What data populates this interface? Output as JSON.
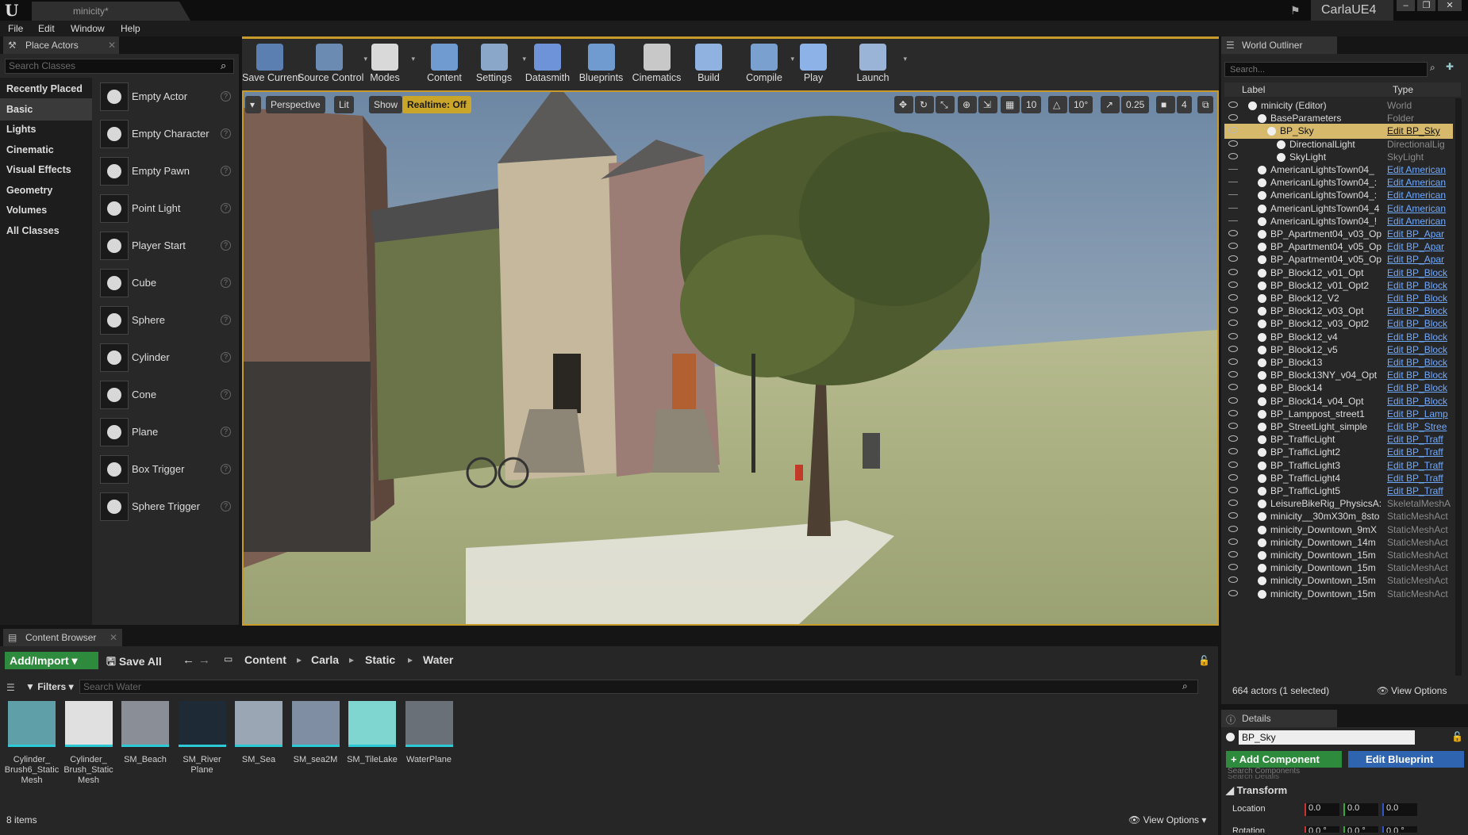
{
  "window": {
    "document_tab": "minicity*",
    "project_name": "CarlaUE4",
    "menus": [
      "File",
      "Edit",
      "Window",
      "Help"
    ]
  },
  "place_actors": {
    "tab_label": "Place Actors",
    "search_placeholder": "Search Classes",
    "categories": [
      "Recently Placed",
      "Basic",
      "Lights",
      "Cinematic",
      "Visual Effects",
      "Geometry",
      "Volumes",
      "All Classes"
    ],
    "selected_category": "Basic",
    "items": [
      "Empty Actor",
      "Empty Character",
      "Empty Pawn",
      "Point Light",
      "Player Start",
      "Cube",
      "Sphere",
      "Cylinder",
      "Cone",
      "Plane",
      "Box Trigger",
      "Sphere Trigger"
    ]
  },
  "toolbar": {
    "tools": [
      {
        "label": "Save Current",
        "icon": "save-icon",
        "color": "#5a7fb0"
      },
      {
        "label": "Source Control",
        "icon": "source-control-icon",
        "color": "#6c8bb2"
      },
      {
        "label": "Modes",
        "icon": "modes-icon",
        "color": "#d9d9d9"
      },
      {
        "label": "Content",
        "icon": "content-icon",
        "color": "#6f9bd1"
      },
      {
        "label": "Settings",
        "icon": "settings-icon",
        "color": "#8aa6c8"
      },
      {
        "label": "Datasmith",
        "icon": "datasmith-icon",
        "color": "#6e93d8"
      },
      {
        "label": "Blueprints",
        "icon": "blueprints-icon",
        "color": "#6f9bd1"
      },
      {
        "label": "Cinematics",
        "icon": "cinematics-icon",
        "color": "#c8c8c8"
      },
      {
        "label": "Build",
        "icon": "build-icon",
        "color": "#8fb2e0"
      },
      {
        "label": "Compile",
        "icon": "compile-icon",
        "color": "#7aa0d0"
      },
      {
        "label": "Play",
        "icon": "play-icon",
        "color": "#8db2e8"
      },
      {
        "label": "Launch",
        "icon": "launch-icon",
        "color": "#9ab4d8"
      }
    ]
  },
  "viewport": {
    "perspective_label": "Perspective",
    "lit_label": "Lit",
    "show_label": "Show",
    "realtime_label": "Realtime: Off",
    "grid_snap": "10",
    "rotation_snap": "10°",
    "scale_snap": "0.25",
    "camera_speed": "4"
  },
  "outliner": {
    "tab_label": "World Outliner",
    "search_placeholder": "Search...",
    "col_label": "Label",
    "col_type": "Type",
    "rows": [
      {
        "name": "minicity (Editor)",
        "type": "World",
        "level": 1,
        "visible": true,
        "type_link": false,
        "selected": false
      },
      {
        "name": "BaseParameters",
        "type": "Folder",
        "level": 2,
        "visible": true,
        "type_link": false,
        "selected": false
      },
      {
        "name": "BP_Sky",
        "type": "Edit BP_Sky",
        "level": 3,
        "visible": true,
        "type_link": true,
        "selected": true
      },
      {
        "name": "DirectionalLight",
        "type": "DirectionalLig",
        "level": 4,
        "visible": true,
        "type_link": false,
        "selected": false
      },
      {
        "name": "SkyLight",
        "type": "SkyLight",
        "level": 4,
        "visible": true,
        "type_link": false,
        "selected": false
      },
      {
        "name": "AmericanLightsTown04_",
        "type": "Edit American",
        "level": 2,
        "visible": false,
        "type_link": true,
        "selected": false
      },
      {
        "name": "AmericanLightsTown04_:",
        "type": "Edit American",
        "level": 2,
        "visible": false,
        "type_link": true,
        "selected": false
      },
      {
        "name": "AmericanLightsTown04_:",
        "type": "Edit American",
        "level": 2,
        "visible": false,
        "type_link": true,
        "selected": false
      },
      {
        "name": "AmericanLightsTown04_4",
        "type": "Edit American",
        "level": 2,
        "visible": false,
        "type_link": true,
        "selected": false
      },
      {
        "name": "AmericanLightsTown04_!",
        "type": "Edit American",
        "level": 2,
        "visible": false,
        "type_link": true,
        "selected": false
      },
      {
        "name": "BP_Apartment04_v03_Op",
        "type": "Edit BP_Apar",
        "level": 2,
        "visible": true,
        "type_link": true,
        "selected": false
      },
      {
        "name": "BP_Apartment04_v05_Op",
        "type": "Edit BP_Apar",
        "level": 2,
        "visible": true,
        "type_link": true,
        "selected": false
      },
      {
        "name": "BP_Apartment04_v05_Op",
        "type": "Edit BP_Apar",
        "level": 2,
        "visible": true,
        "type_link": true,
        "selected": false
      },
      {
        "name": "BP_Block12_v01_Opt",
        "type": "Edit BP_Block",
        "level": 2,
        "visible": true,
        "type_link": true,
        "selected": false
      },
      {
        "name": "BP_Block12_v01_Opt2",
        "type": "Edit BP_Block",
        "level": 2,
        "visible": true,
        "type_link": true,
        "selected": false
      },
      {
        "name": "BP_Block12_V2",
        "type": "Edit BP_Block",
        "level": 2,
        "visible": true,
        "type_link": true,
        "selected": false
      },
      {
        "name": "BP_Block12_v03_Opt",
        "type": "Edit BP_Block",
        "level": 2,
        "visible": true,
        "type_link": true,
        "selected": false
      },
      {
        "name": "BP_Block12_v03_Opt2",
        "type": "Edit BP_Block",
        "level": 2,
        "visible": true,
        "type_link": true,
        "selected": false
      },
      {
        "name": "BP_Block12_v4",
        "type": "Edit BP_Block",
        "level": 2,
        "visible": true,
        "type_link": true,
        "selected": false
      },
      {
        "name": "BP_Block12_v5",
        "type": "Edit BP_Block",
        "level": 2,
        "visible": true,
        "type_link": true,
        "selected": false
      },
      {
        "name": "BP_Block13",
        "type": "Edit BP_Block",
        "level": 2,
        "visible": true,
        "type_link": true,
        "selected": false
      },
      {
        "name": "BP_Block13NY_v04_Opt",
        "type": "Edit BP_Block",
        "level": 2,
        "visible": true,
        "type_link": true,
        "selected": false
      },
      {
        "name": "BP_Block14",
        "type": "Edit BP_Block",
        "level": 2,
        "visible": true,
        "type_link": true,
        "selected": false
      },
      {
        "name": "BP_Block14_v04_Opt",
        "type": "Edit BP_Block",
        "level": 2,
        "visible": true,
        "type_link": true,
        "selected": false
      },
      {
        "name": "BP_Lamppost_street1",
        "type": "Edit BP_Lamp",
        "level": 2,
        "visible": true,
        "type_link": true,
        "selected": false
      },
      {
        "name": "BP_StreetLight_simple",
        "type": "Edit BP_Stree",
        "level": 2,
        "visible": true,
        "type_link": true,
        "selected": false
      },
      {
        "name": "BP_TrafficLight",
        "type": "Edit BP_Traff",
        "level": 2,
        "visible": true,
        "type_link": true,
        "selected": false
      },
      {
        "name": "BP_TrafficLight2",
        "type": "Edit BP_Traff",
        "level": 2,
        "visible": true,
        "type_link": true,
        "selected": false
      },
      {
        "name": "BP_TrafficLight3",
        "type": "Edit BP_Traff",
        "level": 2,
        "visible": true,
        "type_link": true,
        "selected": false
      },
      {
        "name": "BP_TrafficLight4",
        "type": "Edit BP_Traff",
        "level": 2,
        "visible": true,
        "type_link": true,
        "selected": false
      },
      {
        "name": "BP_TrafficLight5",
        "type": "Edit BP_Traff",
        "level": 2,
        "visible": true,
        "type_link": true,
        "selected": false
      },
      {
        "name": "LeisureBikeRig_PhysicsA:",
        "type": "SkeletalMeshA",
        "level": 2,
        "visible": true,
        "type_link": false,
        "selected": false
      },
      {
        "name": "minicity__30mX30m_8sto",
        "type": "StaticMeshAct",
        "level": 2,
        "visible": true,
        "type_link": false,
        "selected": false
      },
      {
        "name": "minicity_Downtown_9mX",
        "type": "StaticMeshAct",
        "level": 2,
        "visible": true,
        "type_link": false,
        "selected": false
      },
      {
        "name": "minicity_Downtown_14m",
        "type": "StaticMeshAct",
        "level": 2,
        "visible": true,
        "type_link": false,
        "selected": false
      },
      {
        "name": "minicity_Downtown_15m",
        "type": "StaticMeshAct",
        "level": 2,
        "visible": true,
        "type_link": false,
        "selected": false
      },
      {
        "name": "minicity_Downtown_15m",
        "type": "StaticMeshAct",
        "level": 2,
        "visible": true,
        "type_link": false,
        "selected": false
      },
      {
        "name": "minicity_Downtown_15m",
        "type": "StaticMeshAct",
        "level": 2,
        "visible": true,
        "type_link": false,
        "selected": false
      },
      {
        "name": "minicity_Downtown_15m",
        "type": "StaticMeshAct",
        "level": 2,
        "visible": true,
        "type_link": false,
        "selected": false
      }
    ],
    "footer_count": "664 actors (1 selected)",
    "view_options": "View Options"
  },
  "details": {
    "tab_label": "Details",
    "actor_name": "BP_Sky",
    "add_component": "+ Add Component",
    "edit_blueprint": "Edit Blueprint",
    "search_components": "Search Components",
    "search_details": "Search Details",
    "transform_label": "Transform",
    "location_label": "Location",
    "rotation_label": "Rotation",
    "location_values": [
      "0.0",
      "0.0",
      "0.0"
    ],
    "rotation_values": [
      "0.0 °",
      "0.0 °",
      "0.0 °"
    ]
  },
  "content_browser": {
    "tab_label": "Content Browser",
    "add_import": "Add/Import",
    "save_all": "Save All",
    "breadcrumb": [
      "Content",
      "Carla",
      "Static",
      "Water"
    ],
    "filters": "Filters",
    "search_placeholder": "Search Water",
    "assets": [
      {
        "name": "Cylinder_ Brush6_Static Mesh",
        "color": "#5fa0a8"
      },
      {
        "name": "Cylinder_ Brush_Static Mesh",
        "color": "#e0e0e0"
      },
      {
        "name": "SM_Beach",
        "color": "#8a8e96"
      },
      {
        "name": "SM_River Plane",
        "color": "#1e2a36"
      },
      {
        "name": "SM_Sea",
        "color": "#9aa6b4"
      },
      {
        "name": "SM_sea2M",
        "color": "#7f8ea2"
      },
      {
        "name": "SM_TileLake",
        "color": "#7fd6d0"
      },
      {
        "name": "WaterPlane",
        "color": "#6a7078"
      }
    ],
    "items_count": "8 items",
    "view_options": "View Options"
  }
}
